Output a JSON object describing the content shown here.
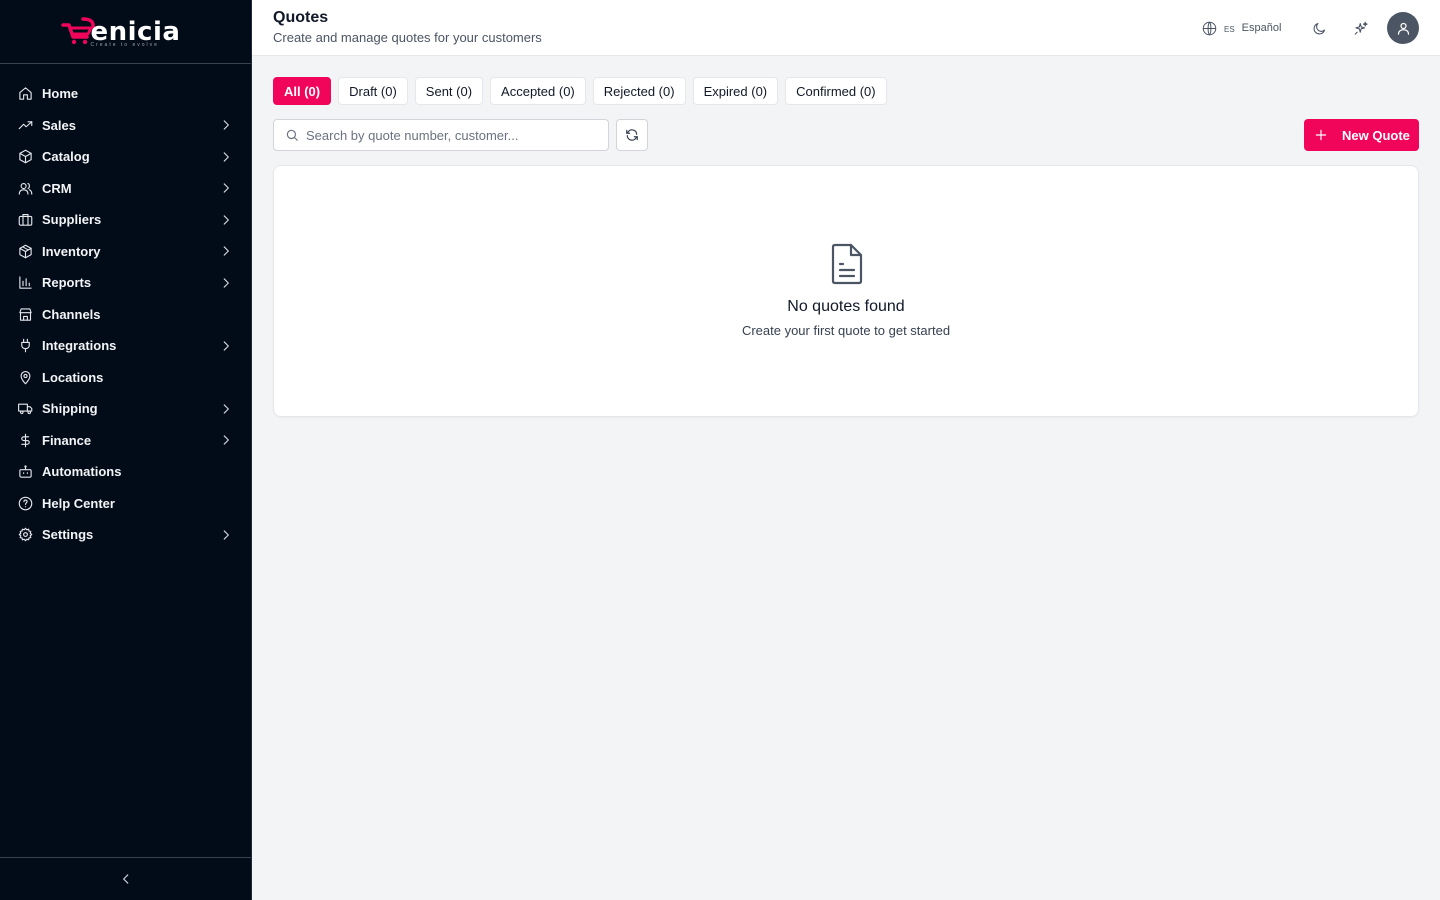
{
  "brand": {
    "name": "enicia",
    "tagline": "Create to evolve",
    "accent_color": "#f0055b"
  },
  "sidebar": {
    "items": [
      {
        "label": "Home",
        "icon": "home-icon",
        "has_children": false
      },
      {
        "label": "Sales",
        "icon": "trending-up-icon",
        "has_children": true
      },
      {
        "label": "Catalog",
        "icon": "box-icon",
        "has_children": true
      },
      {
        "label": "CRM",
        "icon": "users-icon",
        "has_children": true
      },
      {
        "label": "Suppliers",
        "icon": "briefcase-icon",
        "has_children": true
      },
      {
        "label": "Inventory",
        "icon": "package-icon",
        "has_children": true
      },
      {
        "label": "Reports",
        "icon": "bar-chart-icon",
        "has_children": true
      },
      {
        "label": "Channels",
        "icon": "store-icon",
        "has_children": false
      },
      {
        "label": "Integrations",
        "icon": "plug-icon",
        "has_children": true
      },
      {
        "label": "Locations",
        "icon": "map-pin-icon",
        "has_children": false
      },
      {
        "label": "Shipping",
        "icon": "truck-icon",
        "has_children": true
      },
      {
        "label": "Finance",
        "icon": "dollar-icon",
        "has_children": true
      },
      {
        "label": "Automations",
        "icon": "bot-icon",
        "has_children": false
      },
      {
        "label": "Help Center",
        "icon": "help-circle-icon",
        "has_children": false
      },
      {
        "label": "Settings",
        "icon": "gear-icon",
        "has_children": true
      }
    ],
    "collapse_icon": "chevron-left-icon"
  },
  "header": {
    "title": "Quotes",
    "subtitle": "Create and manage quotes for your customers",
    "language_code": "ES",
    "language_name": "Español"
  },
  "tabs": [
    {
      "label": "All (0)",
      "active": true
    },
    {
      "label": "Draft (0)",
      "active": false
    },
    {
      "label": "Sent (0)",
      "active": false
    },
    {
      "label": "Accepted (0)",
      "active": false
    },
    {
      "label": "Rejected (0)",
      "active": false
    },
    {
      "label": "Expired (0)",
      "active": false
    },
    {
      "label": "Confirmed (0)",
      "active": false
    }
  ],
  "search": {
    "placeholder": "Search by quote number, customer...",
    "value": ""
  },
  "actions": {
    "new_quote_label": "New Quote"
  },
  "empty_state": {
    "title": "No quotes found",
    "subtitle": "Create your first quote to get started",
    "icon": "file-text-icon"
  }
}
